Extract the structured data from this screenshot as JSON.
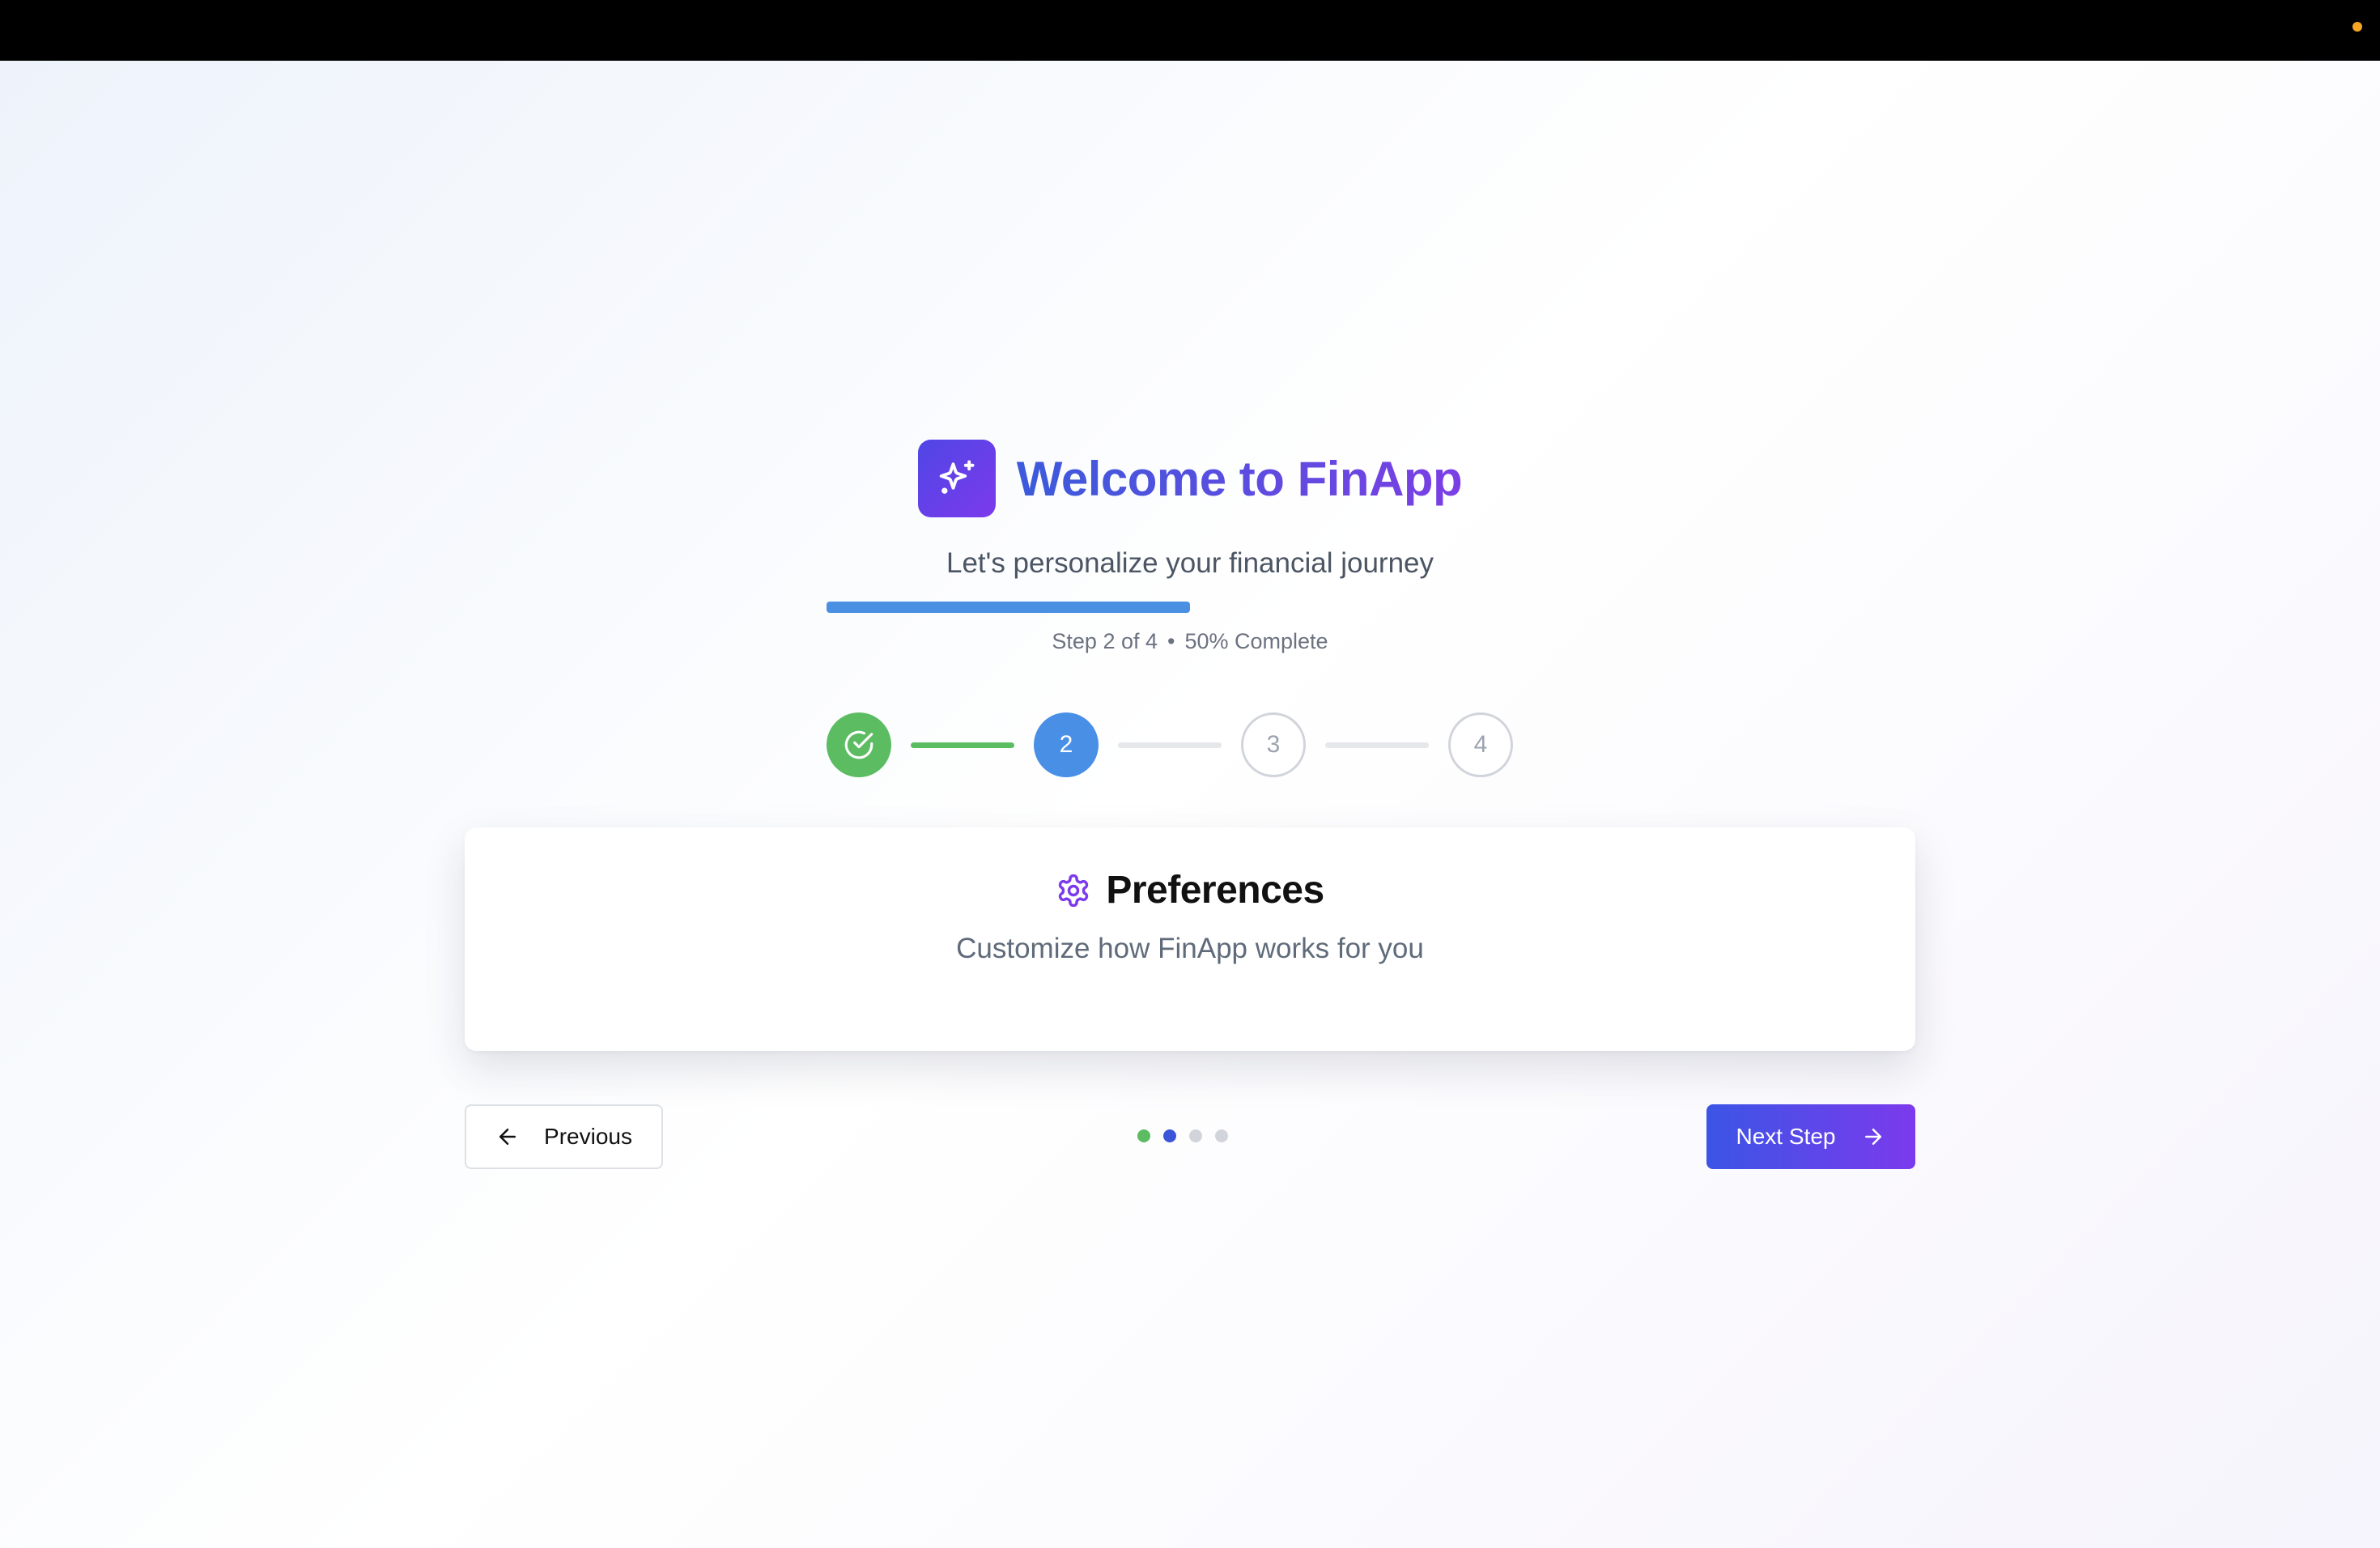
{
  "header": {
    "title": "Welcome to FinApp",
    "logo_icon": "sparkles-icon",
    "subtitle": "Let's personalize your financial journey"
  },
  "progress": {
    "fraction": 0.5,
    "step_text": "Step 2 of 4",
    "separator": "•",
    "percent_text": "50% Complete"
  },
  "stepper": {
    "steps": [
      {
        "label": "",
        "state": "completed",
        "icon": "check-circle-icon"
      },
      {
        "label": "2",
        "state": "active"
      },
      {
        "label": "3",
        "state": "pending"
      },
      {
        "label": "4",
        "state": "pending"
      }
    ]
  },
  "card": {
    "icon": "gear-icon",
    "title": "Preferences",
    "description": "Customize how FinApp works for you"
  },
  "nav": {
    "previous_label": "Previous",
    "next_label": "Next Step",
    "dots": [
      {
        "state": "completed"
      },
      {
        "state": "active"
      },
      {
        "state": "pending"
      },
      {
        "state": "pending"
      }
    ]
  },
  "colors": {
    "completed": "#5cbc62",
    "active": "#4a8fe6",
    "dot_active": "#3b55d9",
    "pending": "#d1d5db",
    "brand_start": "#4f46e5",
    "brand_end": "#7c3aed",
    "status_dot": "#f5a623"
  }
}
